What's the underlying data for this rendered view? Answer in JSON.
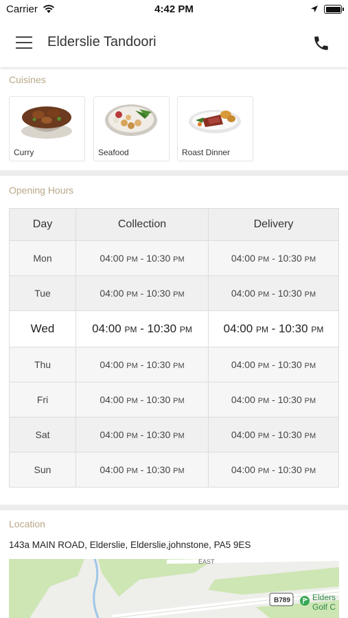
{
  "status_bar": {
    "carrier": "Carrier",
    "time": "4:42 PM"
  },
  "nav": {
    "title": "Elderslie Tandoori"
  },
  "cuisines": {
    "title": "Cuisines",
    "items": [
      {
        "label": "Curry"
      },
      {
        "label": "Seafood"
      },
      {
        "label": "Roast Dinner"
      }
    ]
  },
  "hours": {
    "title": "Opening Hours",
    "headers": {
      "day": "Day",
      "collection": "Collection",
      "delivery": "Delivery"
    },
    "rows": [
      {
        "day": "Mon",
        "collection": {
          "start": "04:00",
          "start_ampm": "PM",
          "end": "10:30",
          "end_ampm": "PM"
        },
        "delivery": {
          "start": "04:00",
          "start_ampm": "PM",
          "end": "10:30",
          "end_ampm": "PM"
        }
      },
      {
        "day": "Tue",
        "collection": {
          "start": "04:00",
          "start_ampm": "PM",
          "end": "10:30",
          "end_ampm": "PM"
        },
        "delivery": {
          "start": "04:00",
          "start_ampm": "PM",
          "end": "10:30",
          "end_ampm": "PM"
        }
      },
      {
        "day": "Wed",
        "collection": {
          "start": "04:00",
          "start_ampm": "PM",
          "end": "10:30",
          "end_ampm": "PM"
        },
        "delivery": {
          "start": "04:00",
          "start_ampm": "PM",
          "end": "10:30",
          "end_ampm": "PM"
        }
      },
      {
        "day": "Thu",
        "collection": {
          "start": "04:00",
          "start_ampm": "PM",
          "end": "10:30",
          "end_ampm": "PM"
        },
        "delivery": {
          "start": "04:00",
          "start_ampm": "PM",
          "end": "10:30",
          "end_ampm": "PM"
        }
      },
      {
        "day": "Fri",
        "collection": {
          "start": "04:00",
          "start_ampm": "PM",
          "end": "10:30",
          "end_ampm": "PM"
        },
        "delivery": {
          "start": "04:00",
          "start_ampm": "PM",
          "end": "10:30",
          "end_ampm": "PM"
        }
      },
      {
        "day": "Sat",
        "collection": {
          "start": "04:00",
          "start_ampm": "PM",
          "end": "10:30",
          "end_ampm": "PM"
        },
        "delivery": {
          "start": "04:00",
          "start_ampm": "PM",
          "end": "10:30",
          "end_ampm": "PM"
        }
      },
      {
        "day": "Sun",
        "collection": {
          "start": "04:00",
          "start_ampm": "PM",
          "end": "10:30",
          "end_ampm": "PM"
        },
        "delivery": {
          "start": "04:00",
          "start_ampm": "PM",
          "end": "10:30",
          "end_ampm": "PM"
        }
      }
    ]
  },
  "location": {
    "title": "Location",
    "address": "143a MAIN ROAD, Elderslie, Elderslie,johnstone, PA5 9ES",
    "map": {
      "road_label": "EAST",
      "road_number": "B789",
      "place_line1": "Elders",
      "place_line2": "Golf C"
    }
  },
  "colors": {
    "section_title": "#b8a888",
    "map_green": "#cde6b4",
    "map_accent": "#34a853"
  }
}
